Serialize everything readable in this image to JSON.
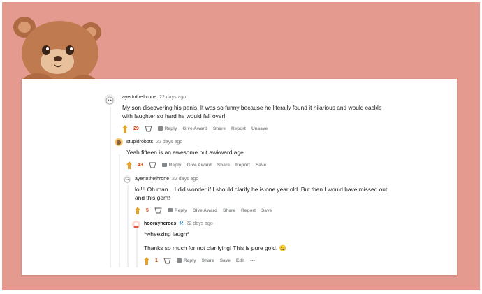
{
  "comments": [
    {
      "user": "ayertothethrone",
      "age": "22 days ago",
      "body": "My son discovering his penis. It was so funny because he literally found it hilarious and would cackle with laughter so hard he would fall over!",
      "score": "29",
      "actions": [
        "Reply",
        "Give Award",
        "Share",
        "Report",
        "Unsave"
      ]
    },
    {
      "user": "stupidrobots",
      "age": "22 days ago",
      "body": "Yeah fifteen is an awesome but awkward age",
      "score": "43",
      "actions": [
        "Reply",
        "Give Award",
        "Share",
        "Report",
        "Save"
      ]
    },
    {
      "user": "ayertothethrone",
      "age": "22 days ago",
      "body": "lol!!! Oh man... I did wonder if I should clarify he is one year old. But then I would have missed out and this gem!",
      "score": "5",
      "actions": [
        "Reply",
        "Give Award",
        "Share",
        "Report",
        "Save"
      ]
    },
    {
      "user": "hoorayheroes",
      "age": "22 days ago",
      "body_line1": "*wheezing laugh*",
      "body_line2": "Thanks so much for not clarifying! This is pure gold. 😄",
      "score": "1",
      "actions": [
        "Reply",
        "Share",
        "Save",
        "Edit",
        "•••"
      ]
    }
  ],
  "colors": {
    "background_pink": "#e59a90",
    "score_orange": "#d93a00",
    "action_gray": "#878a8c"
  }
}
